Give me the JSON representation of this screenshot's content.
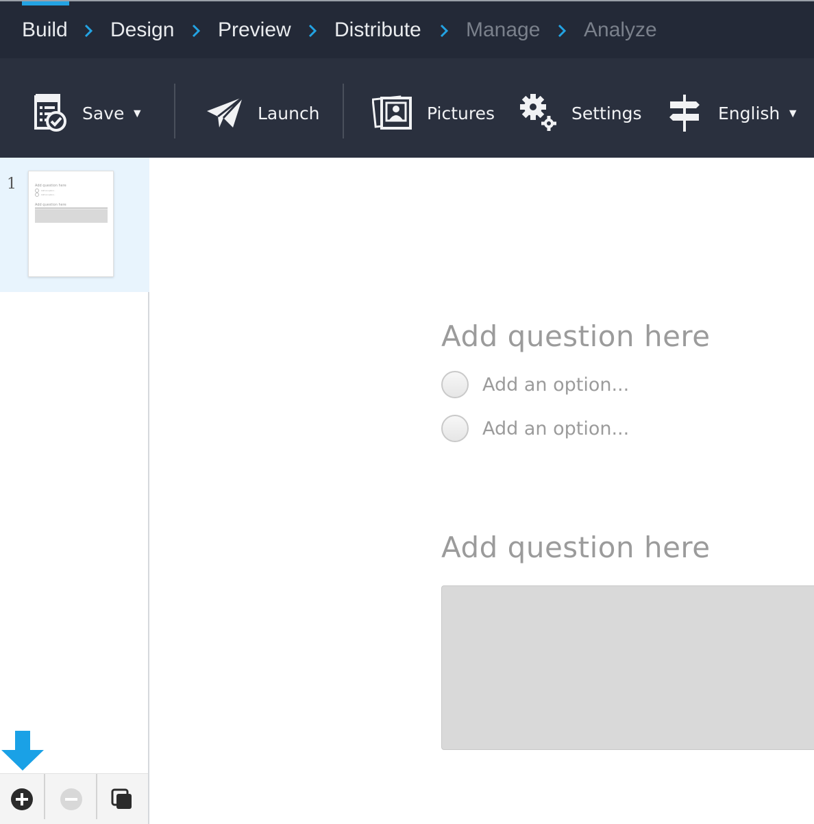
{
  "steps": [
    {
      "label": "Build",
      "active": true
    },
    {
      "label": "Design",
      "active": false
    },
    {
      "label": "Preview",
      "active": false
    },
    {
      "label": "Distribute",
      "active": false
    },
    {
      "label": "Manage",
      "active": false,
      "disabled": true
    },
    {
      "label": "Analyze",
      "active": false,
      "disabled": true
    }
  ],
  "toolbar": {
    "save_label": "Save",
    "launch_label": "Launch",
    "pictures_label": "Pictures",
    "settings_label": "Settings",
    "language_label": "English"
  },
  "pages": [
    {
      "number": "1",
      "thumb_question_1": "Add question here",
      "thumb_option_1": "Add an option...",
      "thumb_option_2": "Add an option...",
      "thumb_question_2": "Add question here"
    }
  ],
  "survey": {
    "question_1": {
      "title": "Add question here",
      "options": [
        "Add an option...",
        "Add an option..."
      ]
    },
    "question_2": {
      "title": "Add question here"
    }
  },
  "colors": {
    "nav_bg": "#232937",
    "toolbar_bg": "#2a303e",
    "accent": "#23a3e3",
    "selected_page_bg": "#e8f4fd",
    "placeholder_text": "#9b9b9b"
  }
}
